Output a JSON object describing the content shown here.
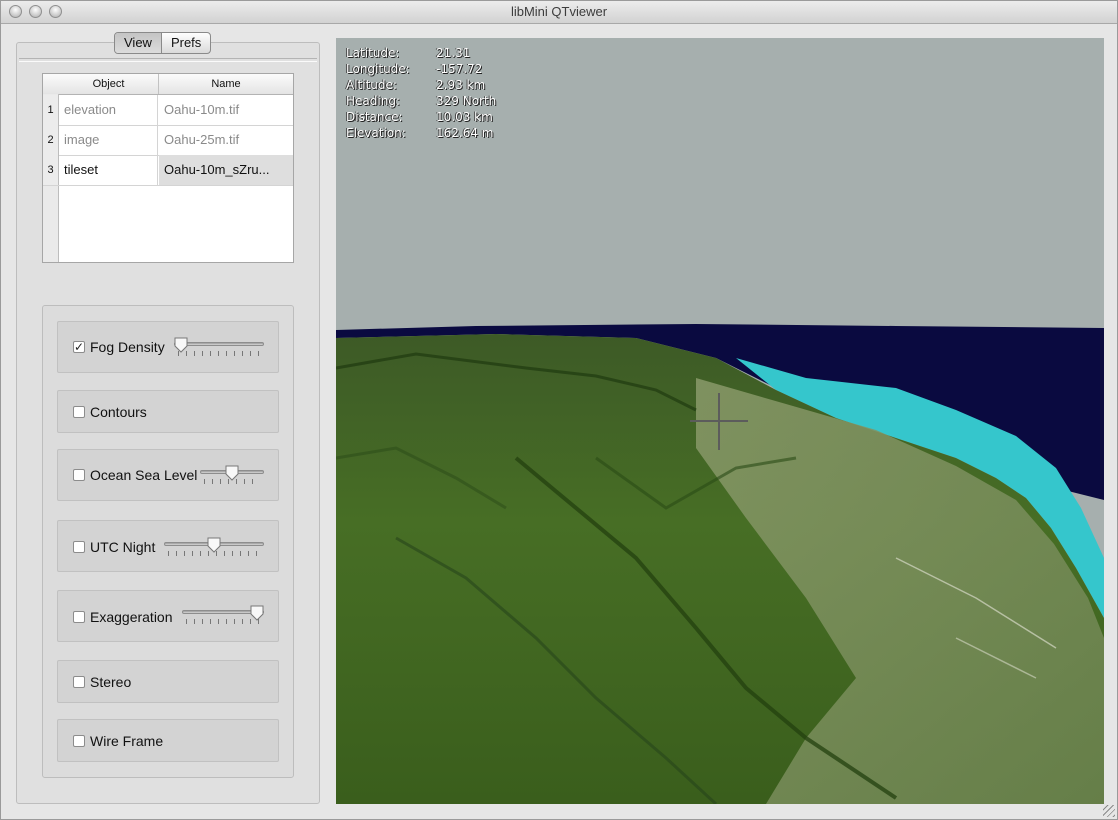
{
  "window": {
    "title": "libMini QTviewer"
  },
  "tabs": [
    {
      "label": "View",
      "active": true
    },
    {
      "label": "Prefs",
      "active": false
    }
  ],
  "table": {
    "headers": [
      "Object",
      "Name"
    ],
    "rows": [
      {
        "num": "1",
        "object": "elevation",
        "name": "Oahu-10m.tif",
        "selected": false
      },
      {
        "num": "2",
        "object": "image",
        "name": "Oahu-25m.tif",
        "selected": false
      },
      {
        "num": "3",
        "object": "tileset",
        "name": "Oahu-10m_sZru...",
        "selected": true
      }
    ]
  },
  "controls": {
    "fog": {
      "label": "Fog Density",
      "checked": true,
      "slider_value": 0.0
    },
    "contours": {
      "label": "Contours",
      "checked": false
    },
    "ocean": {
      "label": "Ocean Sea Level",
      "checked": false,
      "slider_value": 0.5
    },
    "utc": {
      "label": "UTC Night",
      "checked": false,
      "slider_value": 0.5
    },
    "exaggeration": {
      "label": "Exaggeration",
      "checked": false,
      "slider_value": 1.0
    },
    "stereo": {
      "label": "Stereo",
      "checked": false
    },
    "wireframe": {
      "label": "Wire Frame",
      "checked": false
    }
  },
  "hud": {
    "latitude": {
      "label": "Latitude:",
      "value": "21.31"
    },
    "longitude": {
      "label": "Longitude:",
      "value": "-157.72"
    },
    "altitude": {
      "label": "Altitude:",
      "value": "2.93   km"
    },
    "heading": {
      "label": "Heading:",
      "value": "329    North"
    },
    "distance": {
      "label": "Distance:",
      "value": "10.03  km"
    },
    "elevation": {
      "label": "Elevation:",
      "value": "162.64 m"
    }
  },
  "colors": {
    "sky": "#a6afae",
    "ocean": "#0a0a40",
    "shallow_water": "#35c6cc",
    "terrain": "#3f6a24"
  }
}
